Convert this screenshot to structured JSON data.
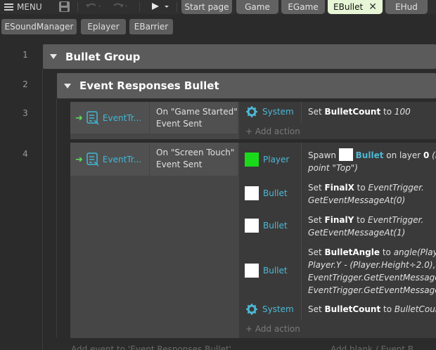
{
  "toolbar": {
    "menu_label": "MENU",
    "tabs": [
      "Start page",
      "Game",
      "EGame",
      "EBullet",
      "EHud"
    ],
    "tabs_row2": [
      "ESoundManager",
      "Eplayer",
      "EBarrier"
    ]
  },
  "sheet": {
    "line_numbers": [
      "1",
      "2",
      "3",
      "4"
    ],
    "group1_title": "Bullet Group",
    "group2_title": "Event Responses Bullet",
    "event1": {
      "cond_obj": "EventTr...",
      "cond_text_line1": "On \"Game Started\"",
      "cond_text_line2": "Event Sent",
      "action_obj": "System",
      "action_text_pre": "Set ",
      "action_var": "BulletCount",
      "action_text_mid": " to ",
      "action_val": "100",
      "add_action": "+ Add action"
    },
    "event2": {
      "cond_obj": "EventTr...",
      "cond_text_line1": "On \"Screen Touch\"",
      "cond_text_line2": "Event Sent",
      "a1_obj": "Player",
      "a1_l1_a": "Spawn ",
      "a1_l1_b": "Bullet",
      "a1_l1_c": " on layer ",
      "a1_l1_d": "0",
      "a1_l1_e": " (im",
      "a1_l2": "point \"Top\")",
      "a2_obj": "Bullet",
      "a2_l1_a": "Set ",
      "a2_l1_b": "FinalX",
      "a2_l1_c": " to ",
      "a2_l1_d": "EventTrigger.",
      "a2_l2": "GetEventMessageAt(0)",
      "a3_obj": "Bullet",
      "a3_l1_a": "Set ",
      "a3_l1_b": "FinalY",
      "a3_l1_c": " to ",
      "a3_l1_d": "EventTrigger.",
      "a3_l2": "GetEventMessageAt(1)",
      "a4_obj": "Bullet",
      "a4_l1_a": "Set ",
      "a4_l1_b": "BulletAngle",
      "a4_l1_c": " to ",
      "a4_l1_d": "angle(Player",
      "a4_l2": "Player.Y - (Player.Height÷2.0),",
      "a4_l3": "EventTrigger.GetEventMessageAt",
      "a4_l4": "EventTrigger.GetEventMessageAt",
      "a5_obj": "System",
      "a5_l1_a": "Set ",
      "a5_l1_b": "BulletCount",
      "a5_l1_c": " to ",
      "a5_l1_d": "BulletCount",
      "add_action": "+ Add action"
    },
    "footer_add_event": "Add event to 'Event Responses Bullet'",
    "footer_right": "Add blank / Event B..."
  },
  "colors": {
    "player_swatch": "#1adb1a",
    "bullet_swatch": "#ffffff",
    "active_tab": "#e6f6d6"
  }
}
